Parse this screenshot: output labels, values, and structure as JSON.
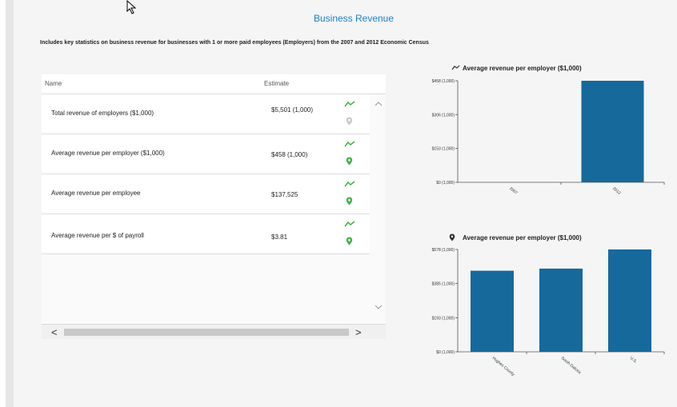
{
  "page": {
    "title": "Business Revenue",
    "subtitle": "Includes key statistics on business revenue for businesses with 1 or more paid employees (Employers) from the 2007 and 2012 Economic Census"
  },
  "table": {
    "headers": {
      "name": "Name",
      "estimate": "Estimate"
    },
    "rows": [
      {
        "label": "Total revenue of employers ($1,000)",
        "value": "$5,501 (1,000)",
        "pin_active": false
      },
      {
        "label": "Average revenue per employer ($1,000)",
        "value": "$458 (1,000)",
        "pin_active": true
      },
      {
        "label": "Average revenue per employee",
        "value": "$137,525",
        "pin_active": true
      },
      {
        "label": "Average revenue per $ of payroll",
        "value": "$3.81",
        "pin_active": true
      }
    ],
    "scroll": {
      "left": "<",
      "right": ">",
      "up": "^",
      "down": "v"
    }
  },
  "colors": {
    "bar": "#16699b",
    "trend_icon": "#3cb54a",
    "pin_active": "#3cb54a",
    "pin_inactive": "#c8c8c8",
    "title_link": "#1f7fc1"
  },
  "chart_data": [
    {
      "type": "bar",
      "title": "Average revenue per employer ($1,000)",
      "icon": "trend-icon",
      "categories": [
        "2007",
        "2012"
      ],
      "values": [
        0,
        458
      ],
      "yticks": [
        "$0 (1,000)",
        "$153 (1,000)",
        "$306 (1,000)",
        "$458 (1,000)"
      ],
      "ylim": [
        0,
        458
      ],
      "xlabel": "",
      "ylabel": ""
    },
    {
      "type": "bar",
      "title": "Average revenue per employer ($1,000)",
      "icon": "map-pin-icon",
      "categories": [
        "Hughes County",
        "South Dakota",
        "U.S."
      ],
      "values": [
        458,
        470,
        578
      ],
      "yticks": [
        "$0 (1,000)",
        "$193 (1,000)",
        "$385 (1,000)",
        "$578 (1,000)"
      ],
      "ylim": [
        0,
        578
      ],
      "xlabel": "",
      "ylabel": ""
    }
  ]
}
